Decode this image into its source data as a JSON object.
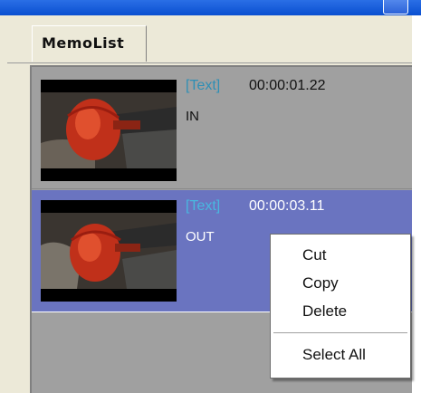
{
  "window": {
    "titlebar_color": "#0a4fd0"
  },
  "tab": {
    "label": "MemoList"
  },
  "memos": [
    {
      "tag": "[Text]",
      "time": "00:00:01.22",
      "label": "IN",
      "selected": false,
      "thumbnail": "glass-vessel-frame-icon"
    },
    {
      "tag": "[Text]",
      "time": "00:00:03.11",
      "label": "OUT",
      "selected": true,
      "thumbnail": "glass-vessel-frame-icon"
    }
  ],
  "context_menu": {
    "items": [
      {
        "label": "Cut"
      },
      {
        "label": "Copy"
      },
      {
        "label": "Delete"
      },
      {
        "label": "Select All"
      }
    ]
  },
  "colors": {
    "selection": "#6a74c0",
    "tag_text": "#3aa3c8",
    "list_background": "#a0a0a0"
  }
}
